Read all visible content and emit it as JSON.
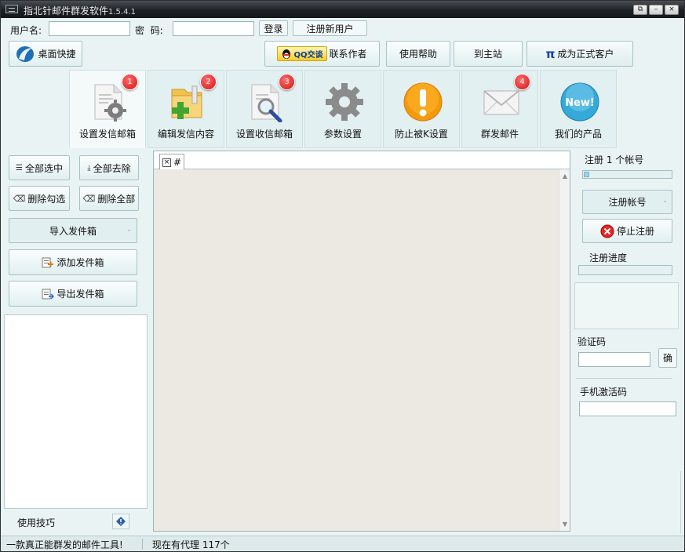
{
  "window": {
    "title": "指北针邮件群发软件",
    "version": "1.5.4.1",
    "controls": [
      "⧉",
      "–",
      "×"
    ]
  },
  "login": {
    "username_label": "用户名:",
    "password_label": "密  码:",
    "username_value": "",
    "password_value": "",
    "login_button": "登录",
    "register_button": "注册新用户"
  },
  "toolbar": {
    "desktop_shortcut": "桌面快捷",
    "qq_badge": "QQ交谈",
    "contact_author": "联系作者",
    "help": "使用帮助",
    "main_site": "到主站",
    "pi_symbol": "π",
    "become_customer": "成为正式客户"
  },
  "tabs": [
    {
      "label": "设置发信邮箱",
      "badge": "1",
      "icon": "gear-document-icon"
    },
    {
      "label": "编辑发信内容",
      "badge": "2",
      "icon": "folder-add-icon"
    },
    {
      "label": "设置收信邮箱",
      "badge": "3",
      "icon": "document-search-icon"
    },
    {
      "label": "参数设置",
      "badge": "",
      "icon": "gear-icon"
    },
    {
      "label": "防止被K设置",
      "badge": "",
      "icon": "warning-icon"
    },
    {
      "label": "群发邮件",
      "badge": "4",
      "icon": "envelope-icon"
    },
    {
      "label": "我们的产品",
      "badge": "",
      "icon": "new-badge-icon"
    }
  ],
  "left_panel": {
    "select_all": "全部选中",
    "remove_all": "全部去除",
    "delete_checked": "删除勾选",
    "delete_all": "删除全部",
    "import_outbox": "导入发件箱",
    "add_outbox": "添加发件箱",
    "export_outbox": "导出发件箱",
    "tips_label": "使用技巧"
  },
  "center": {
    "tab_close": "×",
    "tab_label": "#"
  },
  "right_panel": {
    "register_count_label": "注册 1 个帐号",
    "register_count_progress": 0.06,
    "register_account_select": "注册帐号",
    "stop_register": "停止注册",
    "register_progress_label": "注册进度",
    "register_progress": 0,
    "captcha_label": "验证码",
    "captcha_value": "",
    "confirm_button": "确",
    "phone_code_label": "手机激活码",
    "phone_code_value": ""
  },
  "status": {
    "slogan": "一款真正能群发的邮件工具!",
    "proxy": "现在有代理 117个"
  },
  "colors": {
    "background": "#e9f3f3",
    "badge": "#d41414",
    "title_bar": "#1d2024"
  }
}
